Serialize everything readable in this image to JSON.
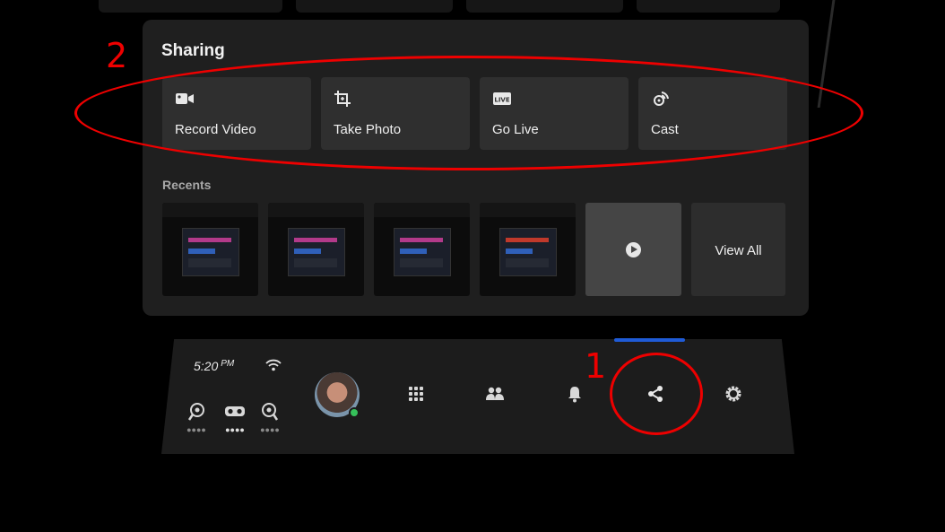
{
  "sharing": {
    "title": "Sharing",
    "actions": [
      {
        "label": "Record Video",
        "icon": "record-video-icon"
      },
      {
        "label": "Take Photo",
        "icon": "take-photo-icon"
      },
      {
        "label": "Go Live",
        "icon": "go-live-icon",
        "badge": "LIVE"
      },
      {
        "label": "Cast",
        "icon": "cast-icon"
      }
    ]
  },
  "recents": {
    "title": "Recents",
    "view_all": "View All"
  },
  "taskbar": {
    "time": "5:20",
    "meridiem": "PM"
  },
  "annotations": {
    "one": "1",
    "two": "2"
  },
  "colors": {
    "accent": "#1f5bd6",
    "annotation": "#e00000",
    "online": "#36c05a"
  }
}
